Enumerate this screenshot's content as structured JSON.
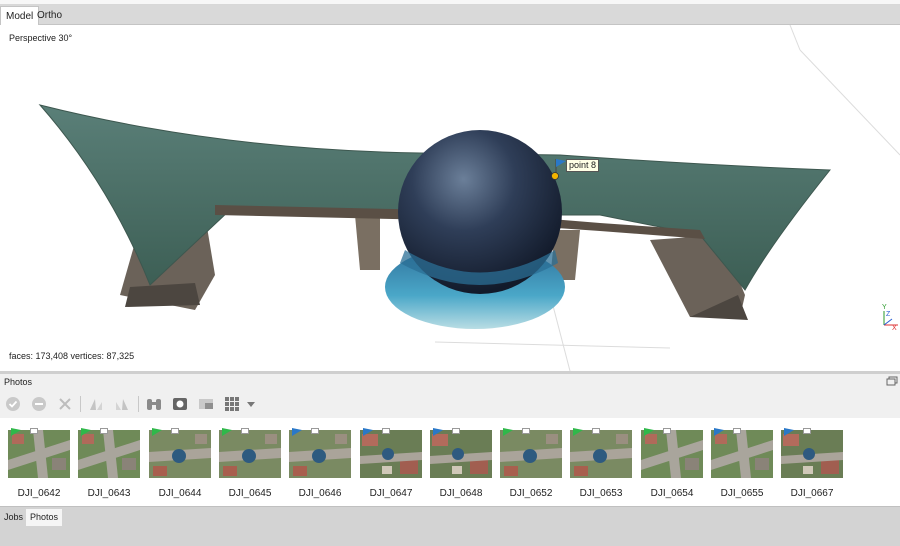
{
  "tabs": [
    {
      "label": "Model"
    },
    {
      "label": "Ortho"
    }
  ],
  "viewport": {
    "projection_label": "Perspective 30°",
    "marker_label": "point 8",
    "stats_label": "faces: 173,408 vertices: 87,325",
    "axis_labels": {
      "y": "Y",
      "z": "Z",
      "x": "X"
    }
  },
  "photos_panel": {
    "title": "Photos",
    "toolbar_icons": [
      "check-icon",
      "minus-circle-icon",
      "close-icon",
      "rotate-left-icon",
      "rotate-right-icon",
      "binoculars-icon",
      "camera-icon",
      "window-icon",
      "grid-view-icon",
      "chevron-down-icon"
    ],
    "photos": [
      {
        "name": "DJI_0642",
        "flag": "green",
        "scene": "road"
      },
      {
        "name": "DJI_0643",
        "flag": "green",
        "scene": "road"
      },
      {
        "name": "DJI_0644",
        "flag": "green",
        "scene": "dome"
      },
      {
        "name": "DJI_0645",
        "flag": "green",
        "scene": "dome"
      },
      {
        "name": "DJI_0646",
        "flag": "blue",
        "scene": "dome"
      },
      {
        "name": "DJI_0647",
        "flag": "blue",
        "scene": "roofs"
      },
      {
        "name": "DJI_0648",
        "flag": "blue",
        "scene": "roofs"
      },
      {
        "name": "DJI_0652",
        "flag": "green",
        "scene": "dome"
      },
      {
        "name": "DJI_0653",
        "flag": "green",
        "scene": "dome"
      },
      {
        "name": "DJI_0654",
        "flag": "green",
        "scene": "road"
      },
      {
        "name": "DJI_0655",
        "flag": "blue",
        "scene": "road"
      },
      {
        "name": "DJI_0667",
        "flag": "blue",
        "scene": "roofs"
      }
    ]
  },
  "bottom_tabs": [
    {
      "label": "Jobs"
    },
    {
      "label": "Photos"
    }
  ],
  "colors": {
    "flag_green": "#2fb84a",
    "flag_blue": "#2a78c8",
    "marker": "#f2b400"
  }
}
